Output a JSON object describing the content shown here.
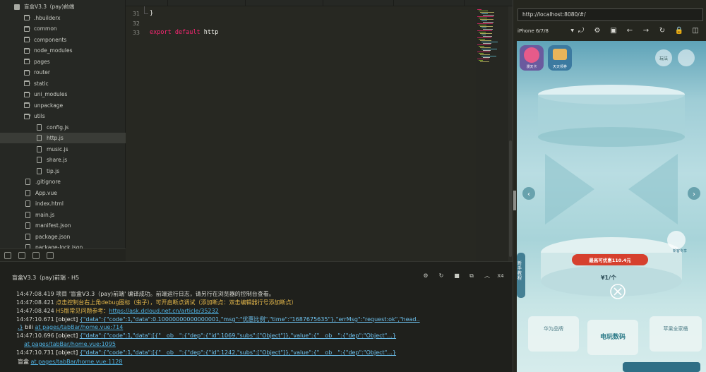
{
  "sidebar": {
    "items": [
      {
        "label": "盲盒V3.3（pay)前端",
        "kind": "project",
        "depth": 0,
        "chevron": "▾"
      },
      {
        "label": ".hbuilderx",
        "kind": "folder",
        "depth": 1,
        "chevron": "›"
      },
      {
        "label": "common",
        "kind": "folder",
        "depth": 1,
        "chevron": "›"
      },
      {
        "label": "components",
        "kind": "folder",
        "depth": 1,
        "chevron": "›"
      },
      {
        "label": "node_modules",
        "kind": "folder",
        "depth": 1,
        "chevron": "›"
      },
      {
        "label": "pages",
        "kind": "folder",
        "depth": 1,
        "chevron": "›"
      },
      {
        "label": "router",
        "kind": "folder",
        "depth": 1,
        "chevron": "›"
      },
      {
        "label": "static",
        "kind": "folder",
        "depth": 1,
        "chevron": "›"
      },
      {
        "label": "uni_modules",
        "kind": "folder",
        "depth": 1,
        "chevron": "›"
      },
      {
        "label": "unpackage",
        "kind": "folder",
        "depth": 1,
        "chevron": "›"
      },
      {
        "label": "utils",
        "kind": "folder",
        "depth": 1,
        "chevron": "▾"
      },
      {
        "label": "config.js",
        "kind": "file",
        "depth": 2,
        "chevron": ""
      },
      {
        "label": "http.js",
        "kind": "file",
        "depth": 2,
        "chevron": "",
        "active": true
      },
      {
        "label": "music.js",
        "kind": "file",
        "depth": 2,
        "chevron": ""
      },
      {
        "label": "share.js",
        "kind": "file",
        "depth": 2,
        "chevron": ""
      },
      {
        "label": "tip.js",
        "kind": "file",
        "depth": 2,
        "chevron": ""
      },
      {
        "label": ".gitignore",
        "kind": "file",
        "depth": 1,
        "chevron": ""
      },
      {
        "label": "App.vue",
        "kind": "file",
        "depth": 1,
        "chevron": ""
      },
      {
        "label": "index.html",
        "kind": "file",
        "depth": 1,
        "chevron": ""
      },
      {
        "label": "main.js",
        "kind": "file",
        "depth": 1,
        "chevron": ""
      },
      {
        "label": "manifest.json",
        "kind": "file",
        "depth": 1,
        "chevron": ""
      },
      {
        "label": "package.json",
        "kind": "file",
        "depth": 1,
        "chevron": ""
      },
      {
        "label": "package-lock.json",
        "kind": "file",
        "depth": 1,
        "chevron": ""
      }
    ]
  },
  "editor": {
    "lines": [
      {
        "num": "31",
        "text": "}"
      },
      {
        "num": "32",
        "text": ""
      },
      {
        "num": "33",
        "kw": "export default",
        "rest": " http"
      }
    ]
  },
  "console": {
    "title": "盲盒V3.3（pay)前端 - H5",
    "close_label": "X4",
    "logs": [
      {
        "ts": "14:47:08.419",
        "msg": "项目 '盲盒V3.3（pay)前端' 编译成功。前端运行日志，请另行在浏览器的控制台查看。"
      },
      {
        "ts": "14:47:08.421",
        "warn": "点击控制台右上角debug图标（虫子），可开启断点调试（添加断点：双击编辑器行号添加断点）"
      },
      {
        "ts": "14:47:08.424",
        "warn": "H5版常见问题参考：",
        "link": "https://ask.dcloud.net.cn/article/35232"
      },
      {
        "ts": "14:47:10.671",
        "prefix": "[object] ",
        "json": "{\"data\":{\"code\":1,\"data\":0.10000000000000001,\"msg\":\"优惠比例\",\"time\":\"1687675635\"},\"errMsg\":\"request:ok\",\"head..",
        "cont": ".}",
        "tag": "  bili  ",
        "src": "at pages/tabBar/home.vue:714"
      },
      {
        "ts": "14:47:10.696",
        "prefix": "[object] ",
        "json": "{\"data\":{\"code\":1,\"data\":[{\"__ob__\":{\"dep\":{\"id\":1069,\"subs\":[\"Object\"]},\"value\":{\"__ob__\":{\"dep\":\"Object\"...}",
        "src": "at pages/tabBar/home.vue:1095"
      },
      {
        "ts": "14:47:10.731",
        "prefix": "[object] ",
        "json": "{\"data\":{\"code\":1,\"data\":[{\"__ob__\":{\"dep\":{\"id\":1242,\"subs\":[\"Object\"]},\"value\":{\"__ob__\":{\"dep\":\"Object\"...}",
        "tag": "  盲盒  ",
        "src": "at pages/tabBar/home.vue:1128"
      }
    ]
  },
  "browser": {
    "url": "http://localhost:8080/#/",
    "device": "iPhone 6/7/8"
  },
  "phone": {
    "top_left_badge_1": "漫天卡",
    "top_left_badge_2": "天天领券",
    "top_right_label": "玩法",
    "promo_text": "最高可优惠110.4元",
    "price_text": "¥1/个",
    "side_tab": "新手教程",
    "bottom_left": "华为品牌",
    "bottom_center": "电玩数码",
    "bottom_right": "苹果全家桶",
    "hand_label": "新客专享"
  }
}
